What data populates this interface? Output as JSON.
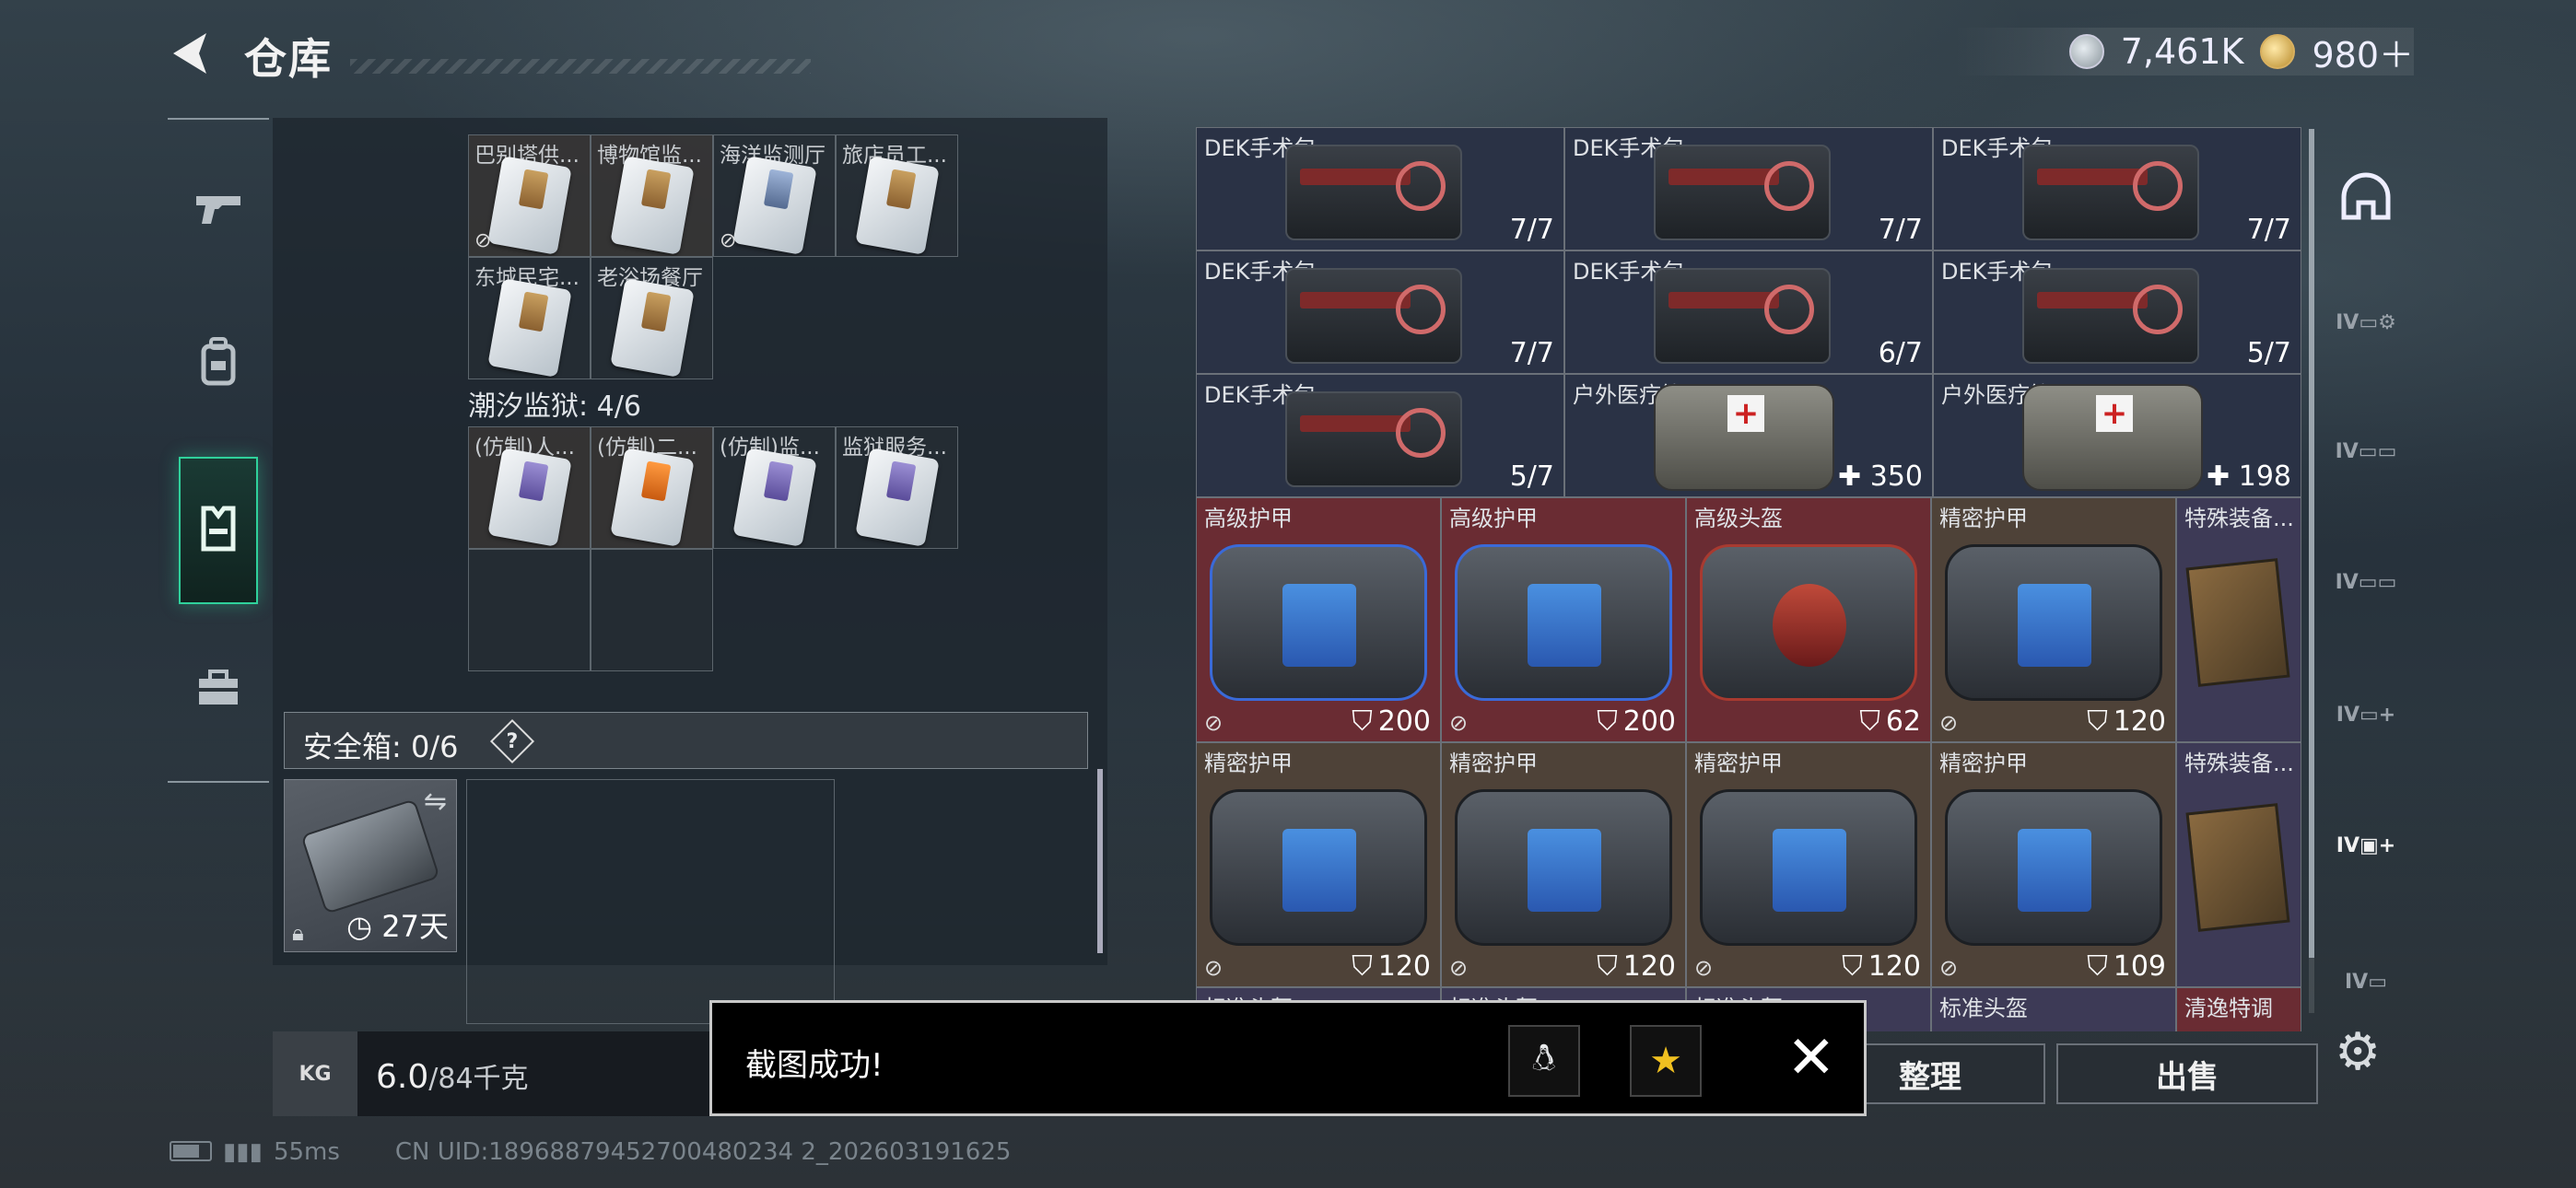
{
  "header": {
    "title": "仓库",
    "coin1": "7,461K",
    "coin2": "980＋"
  },
  "left": {
    "section1_rows": [
      [
        "巴别塔供...",
        "博物馆监...",
        "海洋监测厅",
        "旅店员工..."
      ],
      [
        "东城民宅...",
        "老浴场餐厅"
      ]
    ],
    "section2_label": "潮汐监狱: 4/6",
    "section2_cells": [
      "(仿制)人...",
      "(仿制)二...",
      "(仿制)监...",
      "监狱服务..."
    ],
    "safe_label": "安全箱: 0/6",
    "safe_help": "?",
    "safe_days": "27天",
    "weight_value": "6.0",
    "weight_max": "/84千克",
    "kg_label": "KG"
  },
  "right": {
    "row1": [
      {
        "name": "DEK手术包",
        "qty": "7/7"
      },
      {
        "name": "DEK手术包",
        "qty": "7/7"
      },
      {
        "name": "DEK手术包",
        "qty": "7/7"
      }
    ],
    "row2": [
      {
        "name": "DEK手术包",
        "qty": "7/7"
      },
      {
        "name": "DEK手术包",
        "qty": "6/7"
      },
      {
        "name": "DEK手术包",
        "qty": "5/7"
      }
    ],
    "row3": [
      {
        "name": "DEK手术包",
        "qty": "5/7"
      },
      {
        "name": "户外医疗箱",
        "qty": "350"
      },
      {
        "name": "户外医疗箱",
        "qty": "198"
      }
    ],
    "row4": [
      {
        "name": "高级护甲",
        "val": "200"
      },
      {
        "name": "高级护甲",
        "val": "200"
      },
      {
        "name": "高级头盔",
        "val": "62"
      },
      {
        "name": "精密护甲",
        "val": "120"
      },
      {
        "name": "特殊装备..."
      }
    ],
    "row5": [
      {
        "name": "精密护甲",
        "val": "120"
      },
      {
        "name": "精密护甲",
        "val": "120"
      },
      {
        "name": "精密护甲",
        "val": "120"
      },
      {
        "name": "精密护甲",
        "val": "109"
      },
      {
        "name": "特殊装备..."
      }
    ],
    "row6": [
      {
        "name": "标准头盔"
      },
      {
        "name": "标准头盔"
      },
      {
        "name": "标准头盔"
      },
      {
        "name": "标准头盔"
      },
      {
        "name": "清逸特调"
      }
    ]
  },
  "buttons": {
    "sort": "整理",
    "sell": "出售"
  },
  "toast": {
    "text": "截图成功!"
  },
  "footer": {
    "ping": "55ms",
    "uid": "CN UID:18968879452700480234 2_202603191625"
  },
  "icons": {
    "back": "back-arrow-icon",
    "rail": [
      "pistol-icon",
      "backpack-icon",
      "vest-icon",
      "toolbox-icon"
    ],
    "right_rail": [
      "helmet-filter-icon",
      "iv-filter-icon",
      "settings-gear-icon"
    ],
    "toast": [
      "qq-share-icon",
      "qzone-share-icon",
      "close-icon"
    ]
  },
  "colors": {
    "accent": "#2fd19b",
    "red_tier": "#6a2c33",
    "brown_tier": "#4e4238",
    "purple_tier": "#3d3a56",
    "navy_tier": "#2a3245"
  }
}
